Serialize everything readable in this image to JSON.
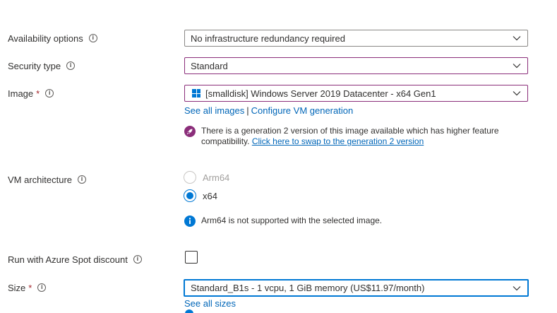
{
  "fields": {
    "availability": {
      "label": "Availability options",
      "value": "No infrastructure redundancy required"
    },
    "security": {
      "label": "Security type",
      "value": "Standard"
    },
    "image": {
      "label": "Image",
      "required_mark": "*",
      "value": "[smalldisk] Windows Server 2019 Datacenter - x64 Gen1",
      "link_all": "See all images",
      "link_separator": "|",
      "link_configure": "Configure VM generation",
      "notice_text": "There is a generation 2 version of this image available which has higher feature compatibility.",
      "notice_link": "Click here to swap to the generation 2 version"
    },
    "architecture": {
      "label": "VM architecture",
      "options": [
        {
          "label": "Arm64",
          "state": "disabled"
        },
        {
          "label": "x64",
          "state": "selected"
        }
      ],
      "notice_text": "Arm64 is not supported with the selected image."
    },
    "spot": {
      "label": "Run with Azure Spot discount",
      "checked": false
    },
    "size": {
      "label": "Size",
      "required_mark": "*",
      "value": "Standard_B1s - 1 vcpu, 1 GiB memory (US$11.97/month)",
      "link_all": "See all sizes"
    }
  },
  "icons": {
    "info": "info-icon",
    "chevron": "chevron-down-icon",
    "windows": "windows-icon",
    "rocket": "rocket-icon",
    "info_filled": "info-filled-icon"
  },
  "colors": {
    "accent_blue": "#0078d4",
    "link_blue": "#0066b8",
    "focus_purple": "#8b2e7a",
    "rocket_purple": "#8b2e7a",
    "required_red": "#a4262c"
  }
}
